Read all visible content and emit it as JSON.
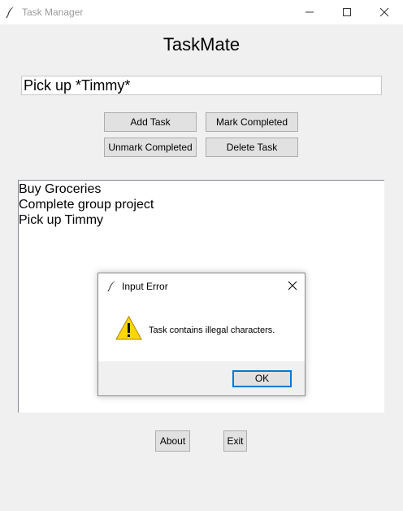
{
  "window": {
    "title": "Task Manager",
    "icon": "feather-icon",
    "controls": [
      "minimize-icon",
      "maximize-icon",
      "close-icon"
    ]
  },
  "app": {
    "heading": "TaskMate",
    "task_input_value": "Pick up *Timmy*"
  },
  "buttons": {
    "add_task": "Add Task",
    "mark_completed": "Mark Completed",
    "unmark_completed": "Unmark Completed",
    "delete_task": "Delete Task",
    "about": "About",
    "exit": "Exit"
  },
  "tasks": [
    "Buy Groceries",
    "Complete group project",
    "Pick up Timmy"
  ],
  "dialog": {
    "title": "Input Error",
    "icon": "feather-icon",
    "warning_icon": "warning-icon",
    "message": "Task contains illegal characters.",
    "ok_label": "OK"
  },
  "colors": {
    "window_bg": "#f0f0f0",
    "focus_border": "#0078d7",
    "warning_fill": "#ffd700"
  }
}
